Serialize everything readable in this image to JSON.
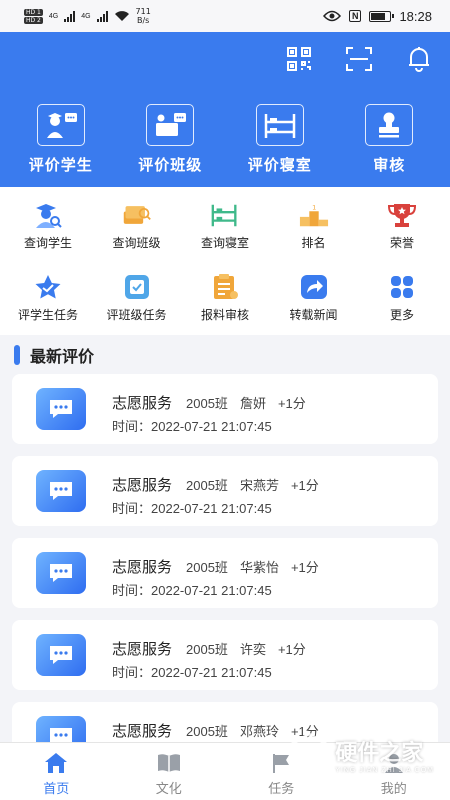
{
  "status_bar": {
    "sim1": "HD 1",
    "sim2": "HD 2",
    "net1": "4G",
    "net2": "4G",
    "speed_value": "711",
    "speed_unit": "B/s",
    "nfc": "N",
    "time": "18:28"
  },
  "header": {
    "top_icons": [
      "qr-code-icon",
      "scan-icon",
      "bell-icon"
    ],
    "actions": [
      {
        "label": "评价学生",
        "icon": "teacher-student-icon"
      },
      {
        "label": "评价班级",
        "icon": "class-board-icon"
      },
      {
        "label": "评价寝室",
        "icon": "bunk-bed-icon"
      },
      {
        "label": "审核",
        "icon": "stamp-icon"
      }
    ],
    "background": "#3a7bee"
  },
  "grid": {
    "row1": [
      {
        "label": "查询学生",
        "icon": "search-student-icon"
      },
      {
        "label": "查询班级",
        "icon": "search-class-icon"
      },
      {
        "label": "查询寝室",
        "icon": "search-dorm-icon"
      },
      {
        "label": "排名",
        "icon": "podium-icon"
      },
      {
        "label": "荣誉",
        "icon": "trophy-icon"
      }
    ],
    "row2": [
      {
        "label": "评学生任务",
        "icon": "star-task-icon"
      },
      {
        "label": "评班级任务",
        "icon": "check-task-icon"
      },
      {
        "label": "报料审核",
        "icon": "clipboard-icon"
      },
      {
        "label": "转载新闻",
        "icon": "share-icon"
      },
      {
        "label": "更多",
        "icon": "more-icon"
      }
    ]
  },
  "section": {
    "title": "最新评价"
  },
  "evaluations": [
    {
      "service": "志愿服务",
      "class": "2005班",
      "name": "詹妍",
      "points": "+1分",
      "time": "时间：2022-07-21 21:07:45"
    },
    {
      "service": "志愿服务",
      "class": "2005班",
      "name": "宋燕芳",
      "points": "+1分",
      "time": "时间：2022-07-21 21:07:45"
    },
    {
      "service": "志愿服务",
      "class": "2005班",
      "name": "华紫怡",
      "points": "+1分",
      "time": "时间：2022-07-21 21:07:45"
    },
    {
      "service": "志愿服务",
      "class": "2005班",
      "name": "许奕",
      "points": "+1分",
      "time": "时间：2022-07-21 21:07:45"
    },
    {
      "service": "志愿服务",
      "class": "2005班",
      "name": "邓燕玲",
      "points": "+1分",
      "time": ""
    }
  ],
  "bottom_nav": [
    {
      "label": "首页",
      "icon": "home-icon",
      "active": true
    },
    {
      "label": "文化",
      "icon": "book-icon",
      "active": false
    },
    {
      "label": "任务",
      "icon": "flag-icon",
      "active": false
    },
    {
      "label": "我的",
      "icon": "user-icon",
      "active": false
    }
  ],
  "watermark": {
    "text": "硬件之家",
    "sub": "YING JIAN ZHI JIA.COM"
  },
  "colors": {
    "accent": "#3a7bee",
    "orange": "#f0a63a",
    "green": "#3fb98a",
    "red": "#d9413c"
  }
}
